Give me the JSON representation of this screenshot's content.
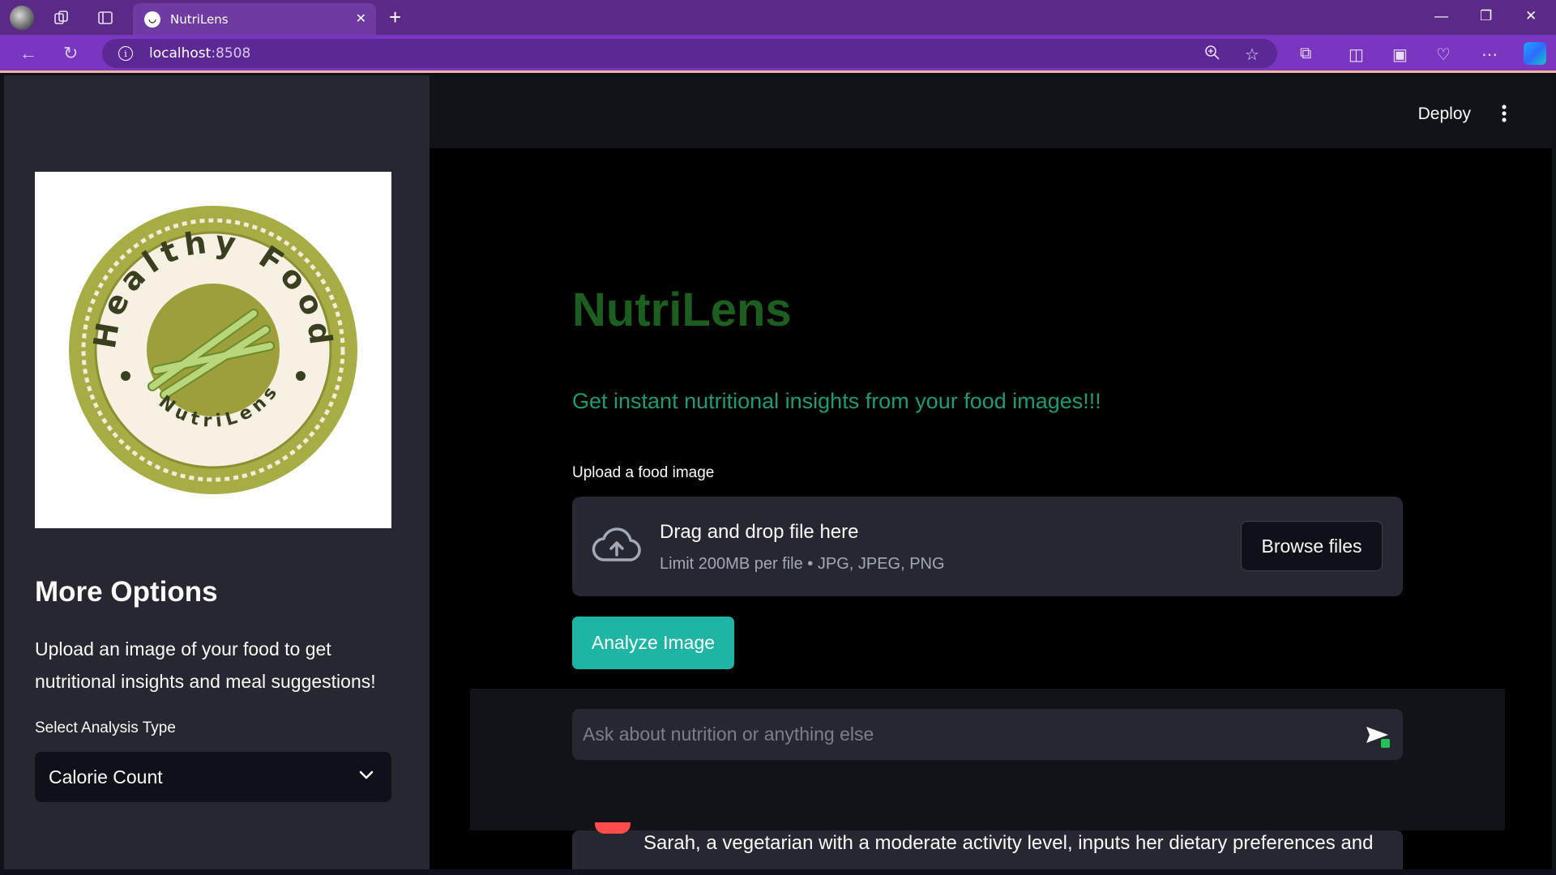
{
  "browser": {
    "tab_title": "NutriLens",
    "url_host": "localhost",
    "url_port": ":8508",
    "accent": "#7a36c0"
  },
  "header": {
    "deploy_label": "Deploy"
  },
  "sidebar": {
    "logo": {
      "ring_text_top": "Healthy Food",
      "ring_text_bottom": "NutriLens"
    },
    "heading": "More Options",
    "description": "Upload an image of your food to get nutritional insights and meal suggestions!",
    "select_label": "Select Analysis Type",
    "select_value": "Calorie Count"
  },
  "main": {
    "title": "NutriLens",
    "subtitle": "Get instant nutritional insights from your food images!!!",
    "upload_label": "Upload a food image",
    "dropzone_title": "Drag and drop file here",
    "dropzone_hint": "Limit 200MB per file • JPG, JPEG, PNG",
    "browse_label": "Browse files",
    "analyze_label": "Analyze Image",
    "chat_placeholder": "Ask about nutrition or anything else",
    "message_text": "Sarah, a vegetarian with a moderate activity level, inputs her dietary preferences and"
  },
  "colors": {
    "title_green": "#1b5e20",
    "subtitle_teal": "#1e9b75",
    "button_teal": "#1fb5a5"
  }
}
